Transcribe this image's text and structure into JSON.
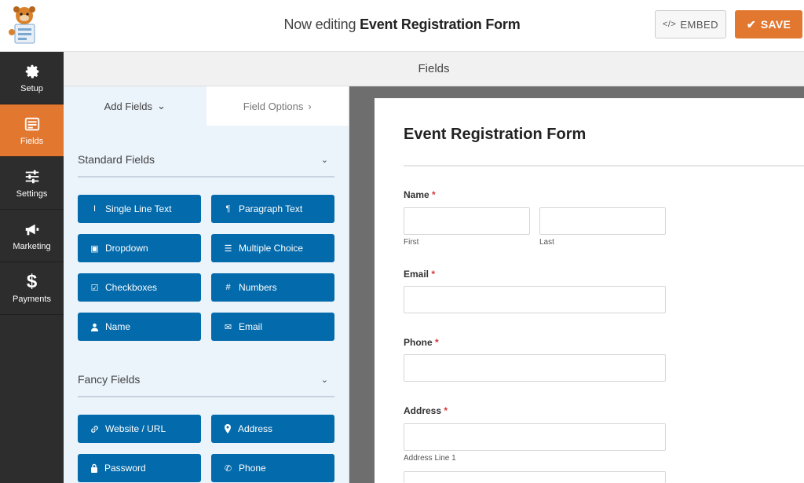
{
  "header": {
    "title_prefix": "Now editing",
    "title_form": "Event Registration Form",
    "embed_label": "EMBED",
    "save_label": "SAVE"
  },
  "sidebar": {
    "items": [
      {
        "label": "Setup",
        "icon": "gear-icon"
      },
      {
        "label": "Fields",
        "icon": "fields-icon",
        "active": true
      },
      {
        "label": "Settings",
        "icon": "sliders-icon"
      },
      {
        "label": "Marketing",
        "icon": "megaphone-icon"
      },
      {
        "label": "Payments",
        "icon": "dollar-icon",
        "glyph": "$"
      }
    ]
  },
  "section_title": "Fields",
  "panel": {
    "tabs": [
      {
        "label": "Add Fields",
        "suffix": "⌄"
      },
      {
        "label": "Field Options",
        "suffix": "›"
      }
    ],
    "standard": {
      "title": "Standard Fields",
      "buttons": [
        {
          "label": "Single Line Text",
          "icon": "text-cursor-icon",
          "glyph": "I"
        },
        {
          "label": "Paragraph Text",
          "icon": "paragraph-icon",
          "glyph": "¶"
        },
        {
          "label": "Dropdown",
          "icon": "dropdown-icon",
          "glyph": "▣"
        },
        {
          "label": "Multiple Choice",
          "icon": "list-icon",
          "glyph": "☰"
        },
        {
          "label": "Checkboxes",
          "icon": "checkbox-icon",
          "glyph": "☑"
        },
        {
          "label": "Numbers",
          "icon": "hash-icon",
          "glyph": "#"
        },
        {
          "label": "Name",
          "icon": "user-icon",
          "glyph": "👤"
        },
        {
          "label": "Email",
          "icon": "envelope-icon",
          "glyph": "✉"
        }
      ]
    },
    "fancy": {
      "title": "Fancy Fields",
      "buttons": [
        {
          "label": "Website / URL",
          "icon": "link-icon",
          "glyph": "🔗"
        },
        {
          "label": "Address",
          "icon": "map-pin-icon",
          "glyph": "📍"
        },
        {
          "label": "Password",
          "icon": "lock-icon",
          "glyph": "🔒"
        },
        {
          "label": "Phone",
          "icon": "phone-icon",
          "glyph": "✆"
        }
      ]
    }
  },
  "form": {
    "title": "Event Registration Form",
    "required_marker": "*",
    "name_label": "Name",
    "first_sublabel": "First",
    "last_sublabel": "Last",
    "email_label": "Email",
    "phone_label": "Phone",
    "address_label": "Address",
    "address_line1_sublabel": "Address Line 1"
  },
  "colors": {
    "accent": "#e27730",
    "field_button": "#036aab",
    "sidebar": "#2d2d2d",
    "panel": "#ebf3fb"
  }
}
